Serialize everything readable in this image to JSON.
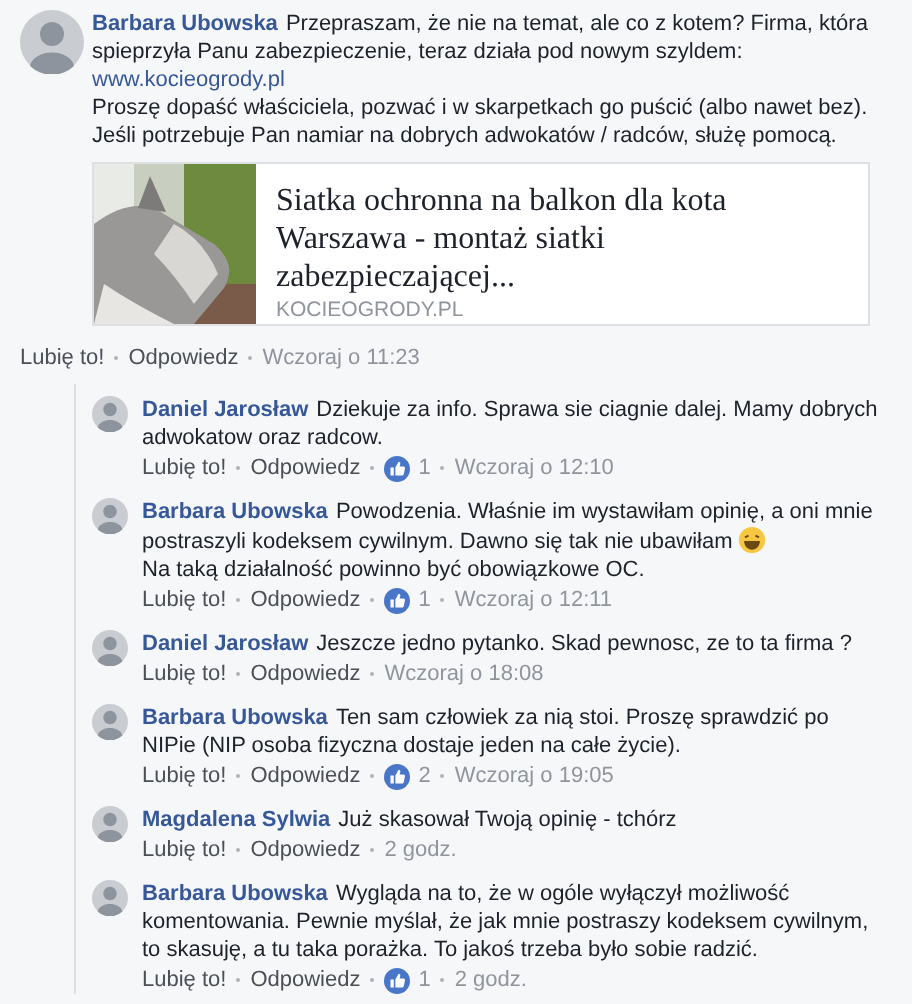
{
  "main_comment": {
    "author": "Barbara Ubowska",
    "segments": [
      {
        "kind": "text",
        "text": "Przepraszam, że nie na temat, ale co z kotem? Firma, która spieprzyła Panu zabezpieczenie, teraz działa pod nowym szyldem:"
      },
      {
        "kind": "link",
        "text": "www.kocieogrody.pl",
        "new_line": true
      },
      {
        "kind": "text",
        "text": "Proszę dopaść właściciela, pozwać i w skarpetkach go puścić (albo nawet bez). Jeśli potrzebuje Pan namiar na dobrych adwokatów / radców, służę pomocą.",
        "new_line": true
      }
    ],
    "preview": {
      "title": "Siatka ochronna na balkon dla kota Warszawa - montaż siatki zabezpieczającej...",
      "domain": "KOCIEOGRODY.PL"
    },
    "like_label": "Lubię to!",
    "reply_label": "Odpowiedz",
    "time": "Wczoraj o 11:23"
  },
  "replies": [
    {
      "author": "Daniel Jarosław",
      "segments": [
        {
          "kind": "text",
          "text": "Dziekuje za info. Sprawa sie ciagnie dalej. Mamy dobrych adwokatow oraz radcow."
        }
      ],
      "like_label": "Lubię to!",
      "reply_label": "Odpowiedz",
      "reactions": "1",
      "time": "Wczoraj o 12:10"
    },
    {
      "author": "Barbara Ubowska",
      "segments": [
        {
          "kind": "text",
          "text": "Powodzenia. Właśnie im wystawiłam opinię, a oni mnie postraszyli kodeksem cywilnym. Dawno się tak nie ubawiłam"
        },
        {
          "kind": "emoji"
        },
        {
          "kind": "text",
          "text": "Na taką działalność powinno być obowiązkowe OC.",
          "new_line": true
        }
      ],
      "like_label": "Lubię to!",
      "reply_label": "Odpowiedz",
      "reactions": "1",
      "time": "Wczoraj o 12:11"
    },
    {
      "author": "Daniel Jarosław",
      "segments": [
        {
          "kind": "text",
          "text": "Jeszcze jedno pytanko. Skad pewnosc, ze to ta firma ?"
        }
      ],
      "like_label": "Lubię to!",
      "reply_label": "Odpowiedz",
      "time": "Wczoraj o 18:08"
    },
    {
      "author": "Barbara Ubowska",
      "segments": [
        {
          "kind": "text",
          "text": "Ten sam człowiek za nią stoi. Proszę sprawdzić po NIPie (NIP osoba fizyczna dostaje jeden na całe życie)."
        }
      ],
      "like_label": "Lubię to!",
      "reply_label": "Odpowiedz",
      "reactions": "2",
      "time": "Wczoraj o 19:05"
    },
    {
      "author": "Magdalena Sylwia",
      "segments": [
        {
          "kind": "text",
          "text": "Już skasował Twoją opinię - tchórz"
        }
      ],
      "like_label": "Lubię to!",
      "reply_label": "Odpowiedz",
      "time": "2 godz."
    },
    {
      "author": "Barbara Ubowska",
      "segments": [
        {
          "kind": "text",
          "text": "Wygląda na to, że w ogóle wyłączył możliwość komentowania. Pewnie myślał, że jak mnie postraszy kodeksem cywilnym, to skasuję, a tu taka porażka. To jakoś trzeba było sobie radzić."
        }
      ],
      "like_label": "Lubię to!",
      "reply_label": "Odpowiedz",
      "reactions": "1",
      "time": "2 godz."
    }
  ]
}
